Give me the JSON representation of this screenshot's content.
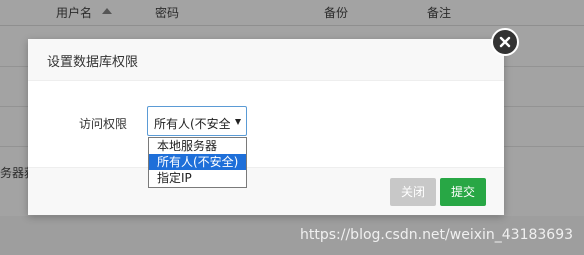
{
  "background_table": {
    "columns": [
      "用户名",
      "密码",
      "备份",
      "备注"
    ],
    "left_cut_label": "务器获"
  },
  "modal": {
    "title": "设置数据库权限",
    "field_label": "访问权限",
    "select": {
      "value": "所有人(不安全)",
      "options": [
        "本地服务器",
        "所有人(不安全)",
        "指定IP"
      ],
      "selected_index": 1
    },
    "buttons": {
      "close": "关闭",
      "submit": "提交"
    }
  },
  "watermark": "https://blog.csdn.net/weixin_43183693",
  "colors": {
    "overlay": "#a3a3a3",
    "accent": "#1e6fd9",
    "submit": "#28a745",
    "close_button": "#c8c8c8"
  },
  "icons": {
    "close": "close-icon",
    "select_arrow": "chevron-down-icon",
    "sort": "sort-up-icon"
  }
}
